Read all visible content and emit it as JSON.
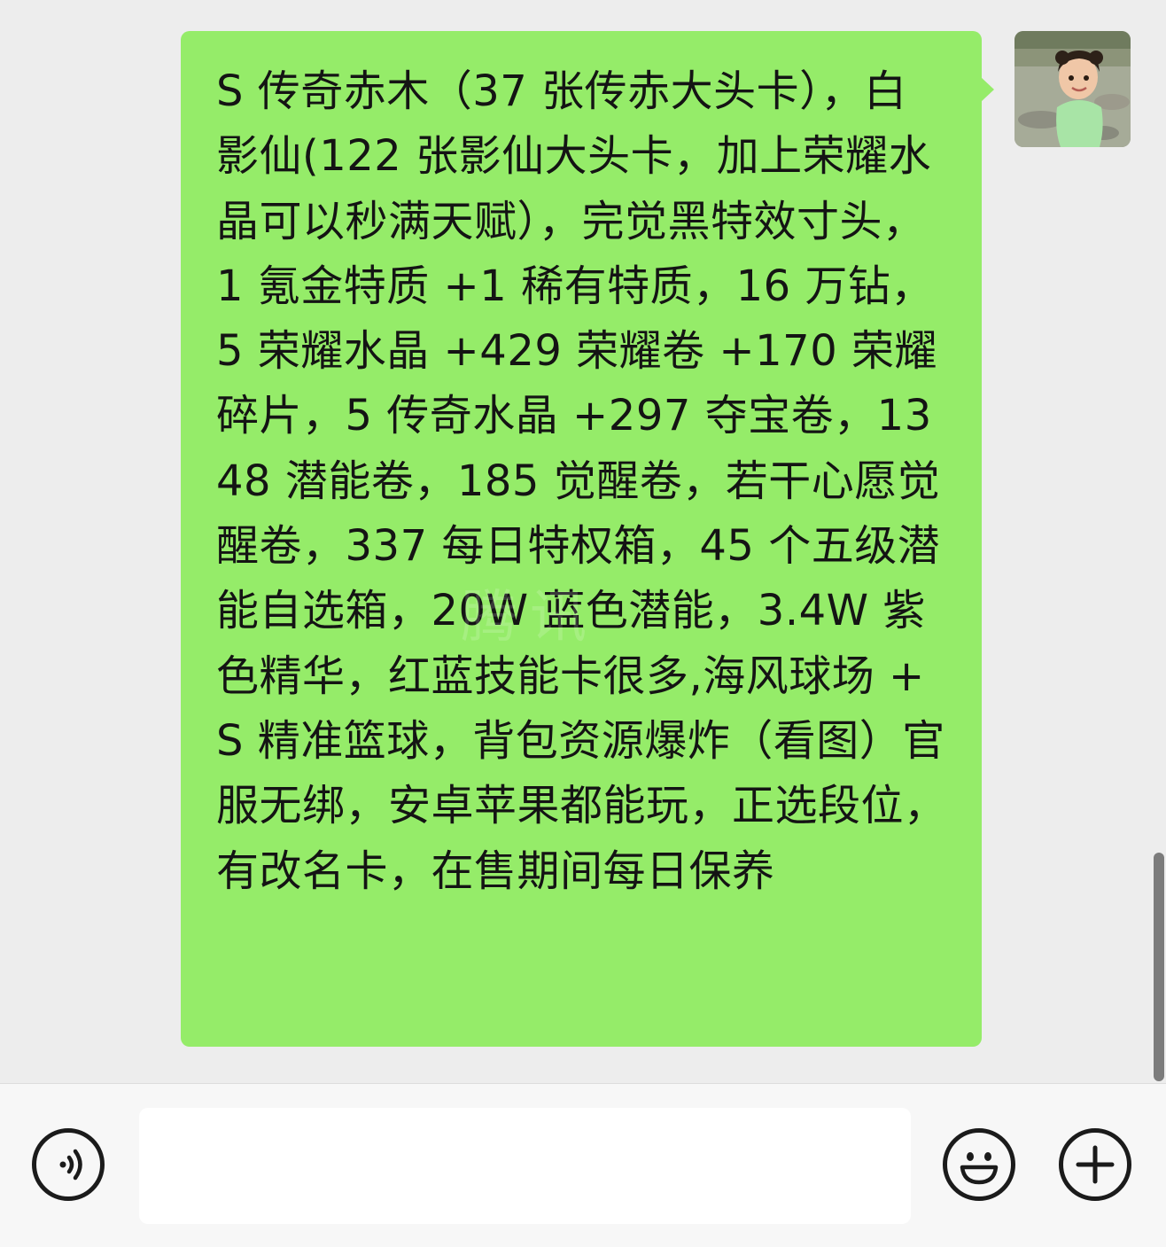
{
  "chat": {
    "message": {
      "text": "S 传奇赤木（37 张传赤大头卡），白影仙(122 张影仙大头卡，加上荣耀水晶可以秒满天赋），完觉黑特效寸头，1 氪金特质 +1 稀有特质，16 万钻，5 荣耀水晶 +429 荣耀卷 +170 荣耀碎片，5 传奇水晶 +297 夺宝卷，1348 潜能卷，185 觉醒卷，若干心愿觉醒卷，337 每日特权箱，45 个五级潜能自选箱，20W 蓝色潜能，3.4W 紫色精华，红蓝技能卡很多,海风球场 +S 精准篮球，背包资源爆炸（看图）官服无绑，安卓苹果都能玩，正选段位，有改名卡，在售期间每日保养",
      "bubble_color": "#95ec69"
    },
    "watermark": "腾讯"
  },
  "input_bar": {
    "voice_icon": "voice-icon",
    "input_value": "",
    "emoji_icon": "emoji-icon",
    "plus_icon": "plus-icon"
  },
  "colors": {
    "background": "#ededed",
    "bubble": "#95ec69",
    "input_bar": "#f7f7f7"
  }
}
